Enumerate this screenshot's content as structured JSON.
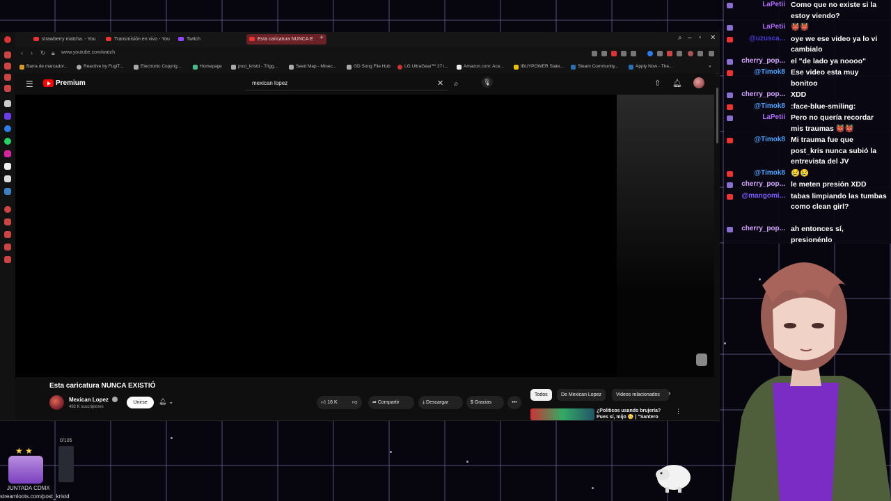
{
  "browser": {
    "tabs": [
      {
        "label": "strawberry matcha. - You"
      },
      {
        "label": "Transmisión en vivo - You"
      },
      {
        "label": "Twitch"
      },
      {
        "label": "Esta caricatura NUNCA E"
      }
    ],
    "url": "www.youtube.com/watch",
    "bookmarks": [
      "Barra de marcador...",
      "Reactive by FugiT...",
      "Electronic Copyrig...",
      "Homepage",
      "post_kristd - Trigg...",
      "Seed Map - Minec...",
      "GD Song File Hub",
      "LG UltraGear™ 27 i...",
      "Amazon.com: Ace...",
      "IBUYPOWER Slate...",
      "Steam Community...",
      "Apply Now - The..."
    ]
  },
  "youtube": {
    "logo_text": "Premium",
    "search_value": "mexican lopez",
    "video_title": "Esta caricatura NUNCA EXISTIÓ",
    "channel_name": "Mexican Lopez",
    "subscribers": "492 K suscriptores",
    "join_label": "Unirse",
    "likes": "16 K",
    "share_label": "Compartir",
    "download_label": "Descargar",
    "thanks_label": "Gracias",
    "chips": [
      "Todos",
      "De Mexican Lopez",
      "Videos relacionados"
    ],
    "reco_title": "¿Politicos usando brujería? Pues sí, mijo 😳 | \"Santero"
  },
  "chat": [
    {
      "user": "LaPetii",
      "text": "Como que no existe si la estoy viendo?",
      "color": "#b06dff"
    },
    {
      "user": "LaPetii",
      "text": "👹👹",
      "color": "#b06dff"
    },
    {
      "user": "@uzusca...",
      "text": "oye we ese video ya lo vi cambialo",
      "color": "#4a3dd9"
    },
    {
      "user": "cherry_pop...",
      "text": "el \"de lado ya noooo\"",
      "color": "#d5a6ff"
    },
    {
      "user": "@Timok8",
      "text": "Ese video esta muy bonitoo",
      "color": "#4fa3ff"
    },
    {
      "user": "cherry_pop...",
      "text": "XDD",
      "color": "#d5a6ff"
    },
    {
      "user": "@Timok8",
      "text": ":face-blue-smiling:",
      "color": "#4fa3ff"
    },
    {
      "user": "LaPetii",
      "text": "Pero no quería recordar mis traumas 👹👹",
      "color": "#b06dff"
    },
    {
      "user": "@Timok8",
      "text": "Mi trauma fue que post_kris nunca subió la entrevista del JV",
      "color": "#4fa3ff"
    },
    {
      "user": "@Timok8",
      "text": "😢😢",
      "color": "#4fa3ff"
    },
    {
      "user": "cherry_pop...",
      "text": "le meten presión XDD",
      "color": "#d5a6ff"
    },
    {
      "user": "@mangomi...",
      "text": "tabas limpiando las tumbas como clean girl?",
      "color": "#7f5cff"
    },
    {
      "user": "cherry_pop...",
      "text": "ah entonces sí, presionénlo",
      "color": "#d5a6ff"
    }
  ],
  "widgets": {
    "goal_counter": "0/105",
    "chest_label": "JUNTADA CDMX",
    "streamloots_url": "streamloots.com/post_kristd"
  },
  "colors": {
    "accent_red": "#ff0000",
    "grid": "#786eaa"
  }
}
